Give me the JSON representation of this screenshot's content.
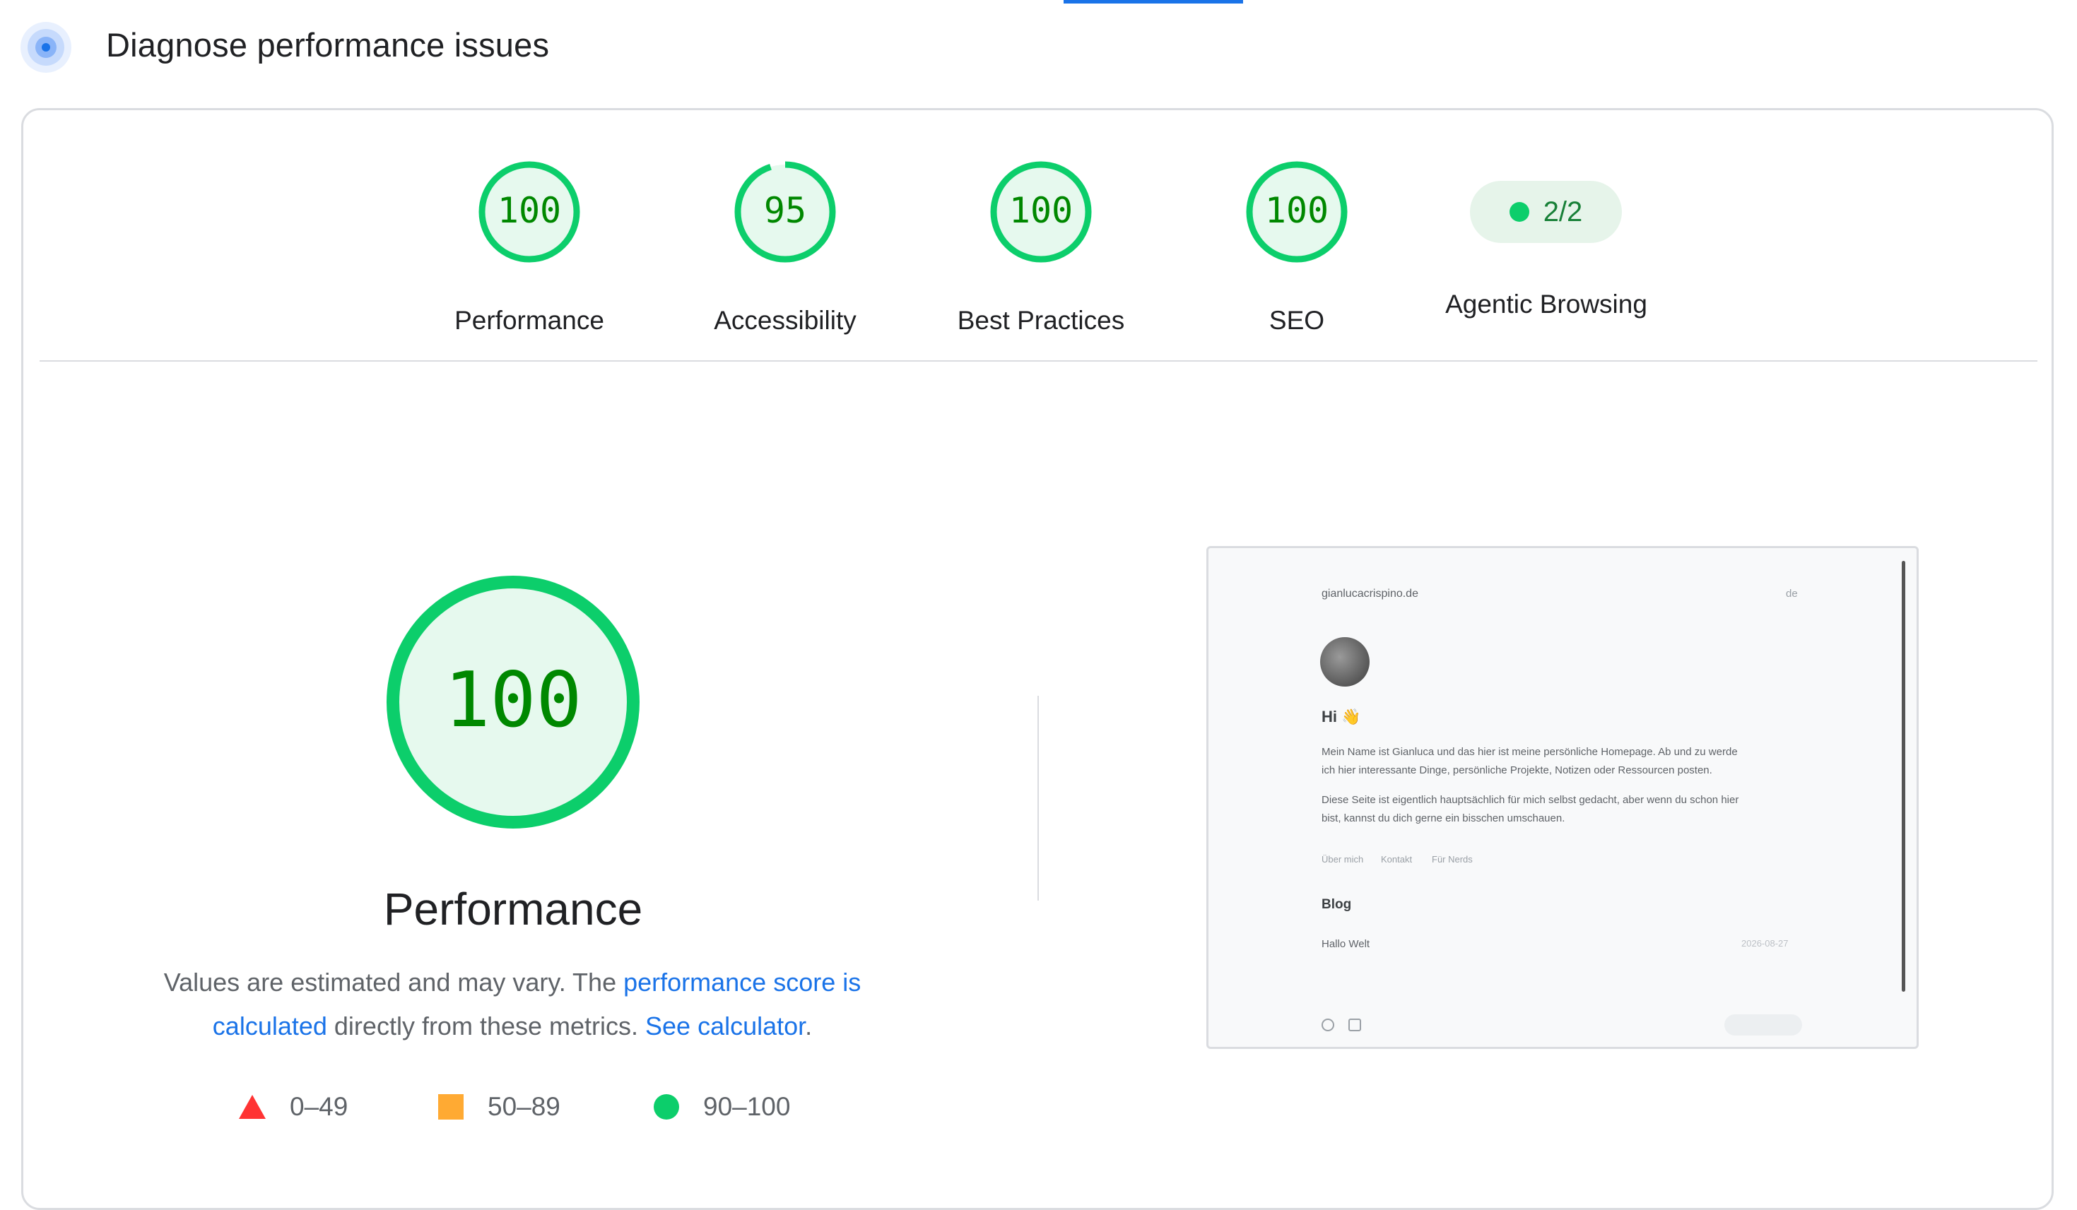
{
  "header": {
    "title": "Diagnose performance issues"
  },
  "scores": [
    {
      "label": "Performance",
      "value": "100",
      "fraction": 1.0
    },
    {
      "label": "Accessibility",
      "value": "95",
      "fraction": 0.95
    },
    {
      "label": "Best Practices",
      "value": "100",
      "fraction": 1.0
    },
    {
      "label": "SEO",
      "value": "100",
      "fraction": 1.0
    }
  ],
  "agentic": {
    "value": "2/2",
    "label": "Agentic Browsing"
  },
  "performance": {
    "value": "100",
    "fraction": 1.0,
    "title": "Performance",
    "desc_part1": "Values are estimated and may vary. The ",
    "desc_link1": "performance score is calculated",
    "desc_part2": " directly from these metrics. ",
    "desc_link2": "See calculator",
    "desc_part3": "."
  },
  "legend": [
    {
      "shape": "triangle",
      "range": "0–49",
      "color": "#ff3333"
    },
    {
      "shape": "square",
      "range": "50–89",
      "color": "#ffaa33"
    },
    {
      "shape": "circle",
      "range": "90–100",
      "color": "#0cce6b"
    }
  ],
  "colors": {
    "pass": "#0cce6b",
    "pass_text": "#008800",
    "pass_bg": "#e6f9ee",
    "accent_link": "#1a73e8"
  },
  "preview": {
    "site": "gianlucacrispino.de",
    "lang": "de",
    "greeting": "Hi 👋",
    "para1_line1": "Mein Name ist Gianluca und das hier ist meine persönliche Homepage. Ab und zu werde",
    "para1_line2": "ich hier interessante Dinge, persönliche Projekte, Notizen oder Ressourcen posten.",
    "para2_line1": "Diese Seite ist eigentlich hauptsächlich für mich selbst gedacht, aber wenn du schon hier",
    "para2_line2": "bist, kannst du dich gerne ein bisschen umschauen.",
    "nav": [
      "Über mich",
      "Kontakt",
      "Für Nerds"
    ],
    "blog_heading": "Blog",
    "post_title": "Hallo Welt",
    "post_date": "2026-08-27"
  }
}
